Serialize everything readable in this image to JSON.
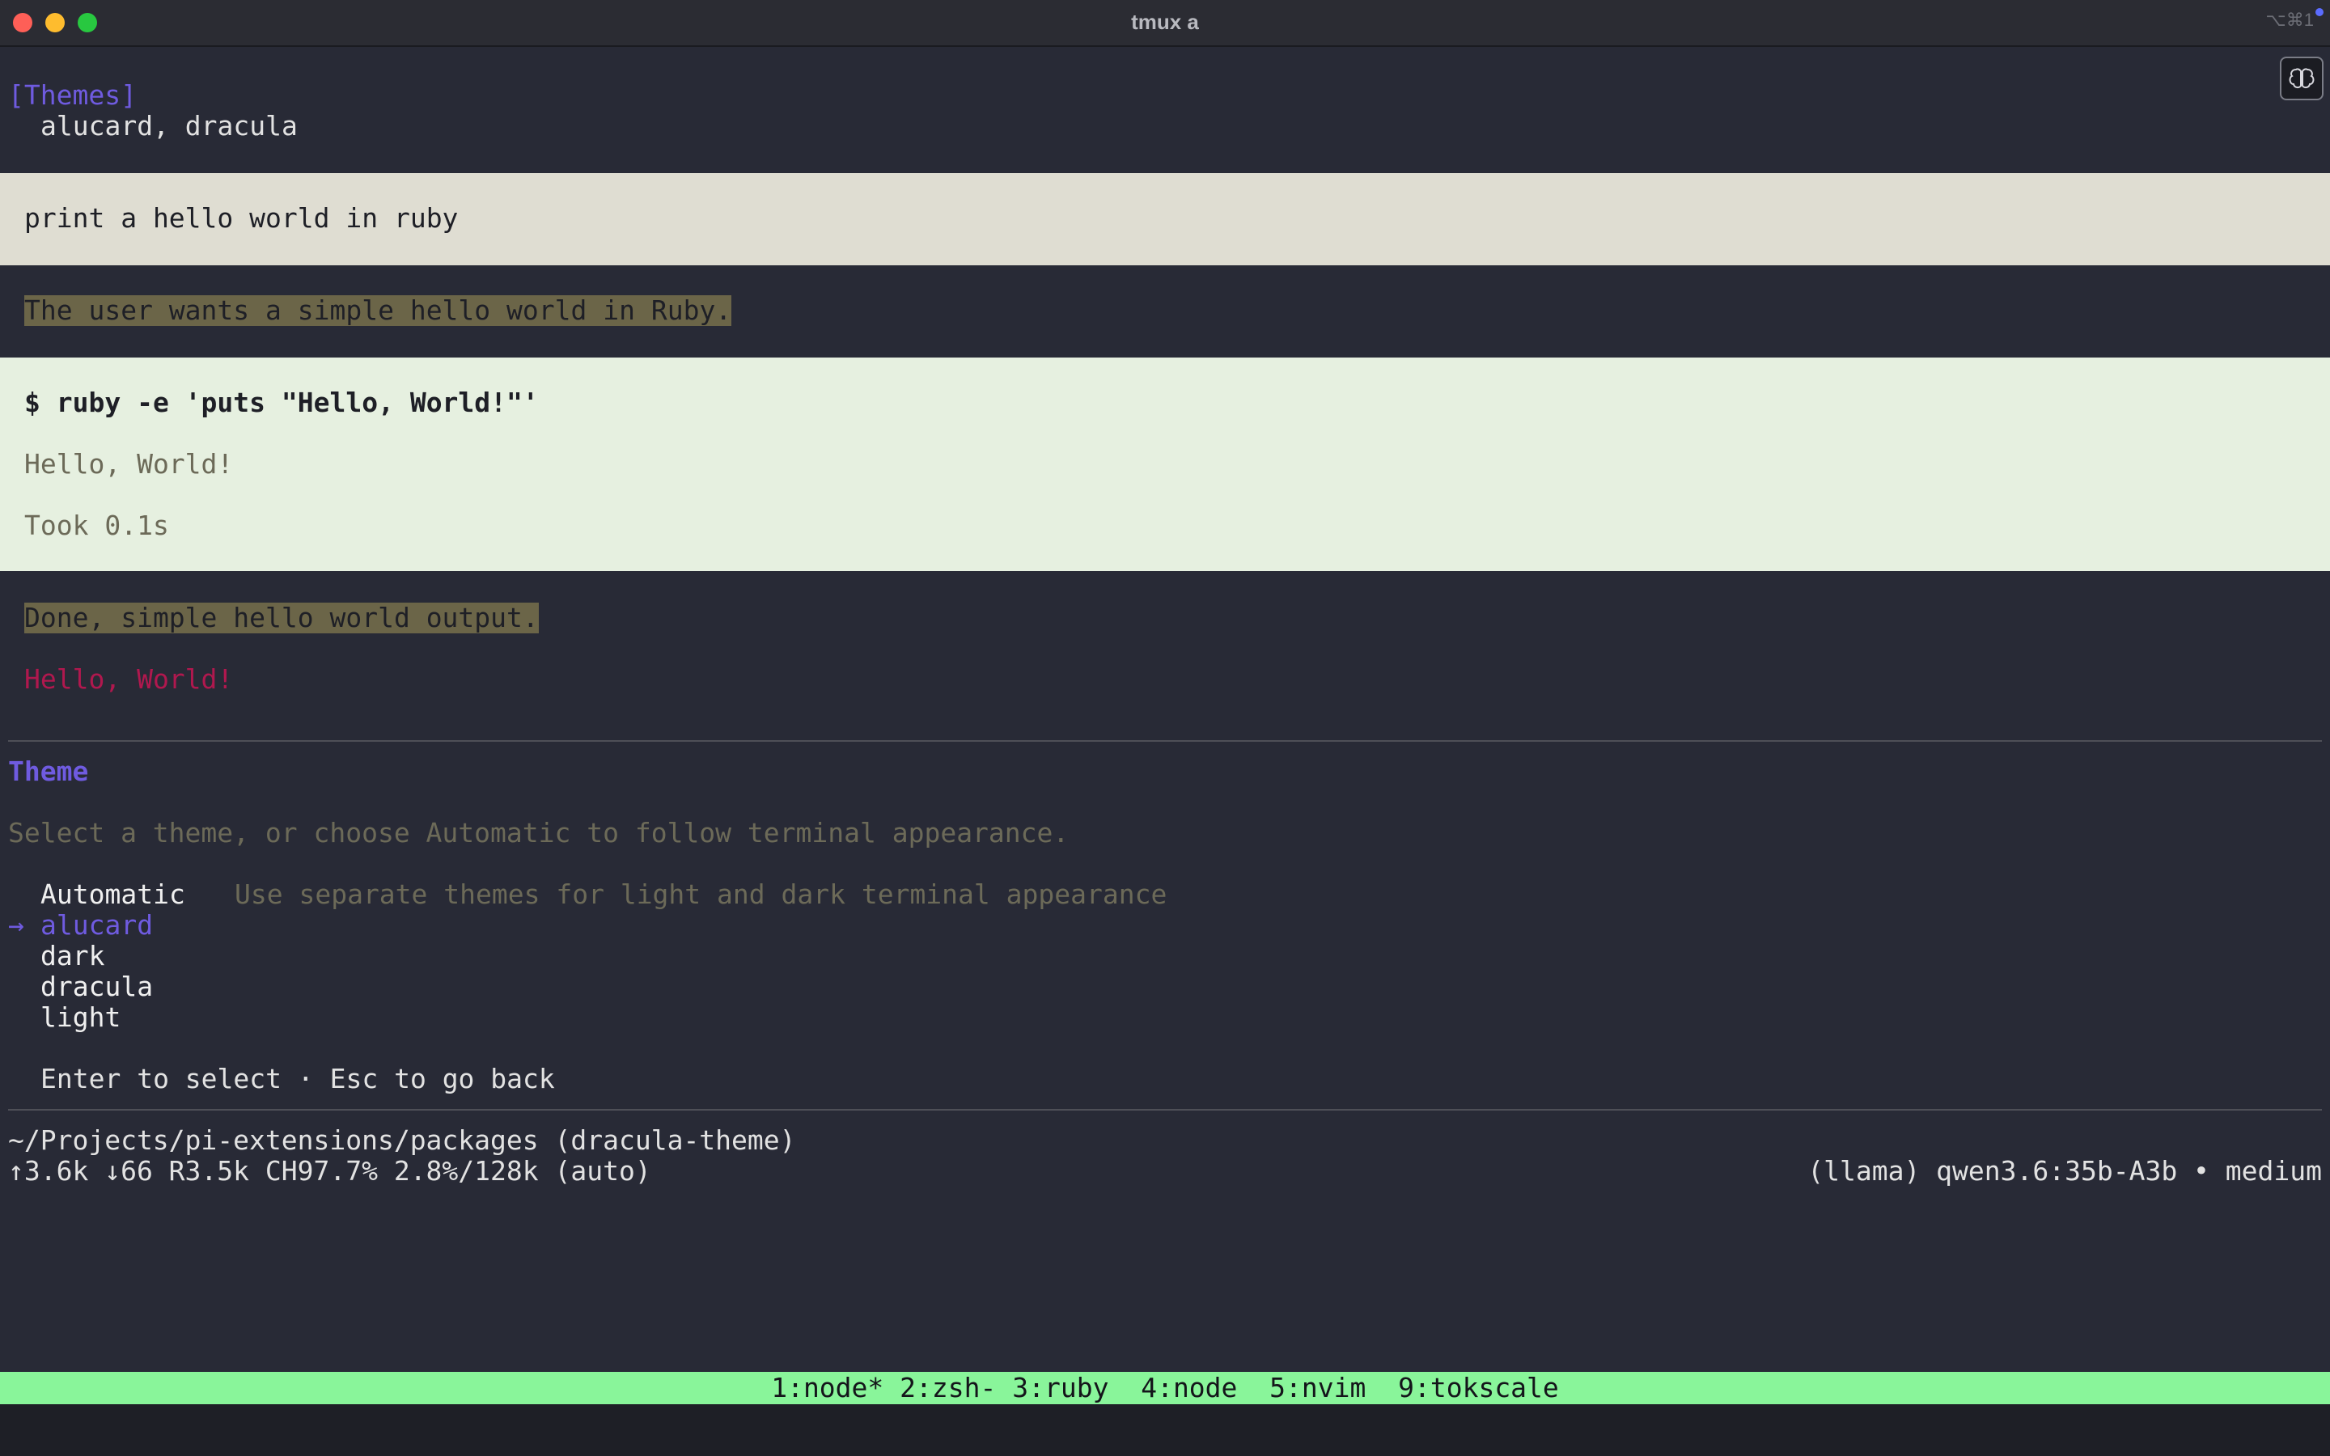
{
  "window": {
    "title": "tmux a",
    "shortcut": "⌥⌘1"
  },
  "chat": {
    "themes_header": "[Themes]",
    "themes_list": "alucard, dracula",
    "user_message": "print a hello world in ruby",
    "thinking_1": "The user wants a simple hello world in Ruby.",
    "tool_command": "$ ruby -e 'puts \"Hello, World!\"'",
    "tool_output": "Hello, World!",
    "tool_duration": "Took 0.1s",
    "thinking_2": "Done, simple hello world output.",
    "assistant_reply": "Hello, World!"
  },
  "theme_picker": {
    "title": "Theme",
    "description": "Select a theme, or choose Automatic to follow terminal appearance.",
    "options": [
      {
        "label": "Automatic",
        "hint": "Use separate themes for light and dark terminal appearance",
        "selected": false
      },
      {
        "label": "alucard",
        "hint": "",
        "selected": true
      },
      {
        "label": "dark",
        "hint": "",
        "selected": false
      },
      {
        "label": "dracula",
        "hint": "",
        "selected": false
      },
      {
        "label": "light",
        "hint": "",
        "selected": false
      }
    ],
    "selection_marker": "→",
    "footer": "Enter to select · Esc to go back"
  },
  "footer": {
    "path": "~/Projects/pi-extensions/packages (dracula-theme)",
    "stats": "↑3.6k ↓66 R3.5k CH97.7% 2.8%/128k (auto)",
    "model": "(llama) qwen3.6:35b-A3b • medium"
  },
  "tmux": {
    "windows": [
      "1:node*",
      "2:zsh-",
      "3:ruby ",
      "4:node ",
      "5:nvim ",
      "9:tokscale"
    ]
  },
  "colors": {
    "accent_purple": "#6f5be0",
    "reply_pink": "#b0184e",
    "status_green": "#89f59a",
    "muted_olive": "#6c6a58"
  }
}
